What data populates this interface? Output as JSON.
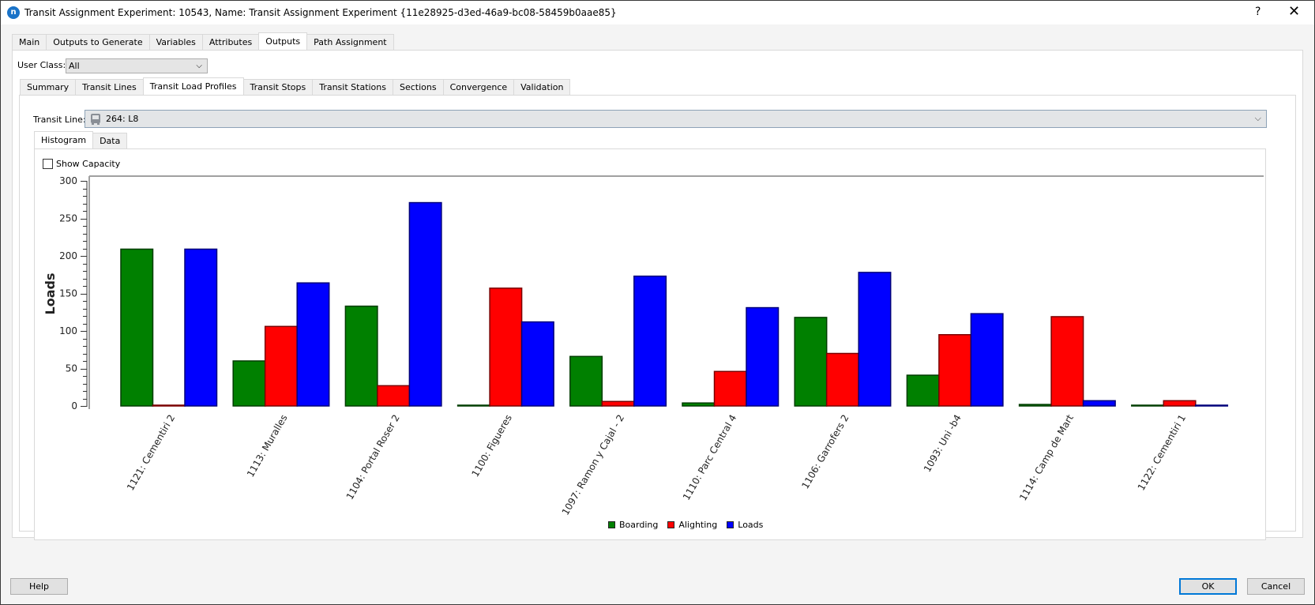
{
  "window": {
    "title": "Transit Assignment Experiment: 10543, Name: Transit Assignment Experiment  {11e28925-d3ed-46a9-bc08-58459b0aae85}",
    "app_icon": "n",
    "help_label": "?",
    "close_label": "✕"
  },
  "top_tabs": [
    {
      "label": "Main",
      "active": false
    },
    {
      "label": "Outputs to Generate",
      "active": false
    },
    {
      "label": "Variables",
      "active": false
    },
    {
      "label": "Attributes",
      "active": false
    },
    {
      "label": "Outputs",
      "active": true
    },
    {
      "label": "Path Assignment",
      "active": false
    }
  ],
  "user_class": {
    "label": "User Class:",
    "value": "All"
  },
  "sub_tabs": [
    {
      "label": "Summary",
      "active": false
    },
    {
      "label": "Transit Lines",
      "active": false
    },
    {
      "label": "Transit Load Profiles",
      "active": true
    },
    {
      "label": "Transit Stops",
      "active": false
    },
    {
      "label": "Transit Stations",
      "active": false
    },
    {
      "label": "Sections",
      "active": false
    },
    {
      "label": "Convergence",
      "active": false
    },
    {
      "label": "Validation",
      "active": false
    }
  ],
  "transit_line": {
    "label": "Transit Line:",
    "value": "264: L8",
    "icon": "bus-icon"
  },
  "view_tabs": [
    {
      "label": "Histogram",
      "active": true
    },
    {
      "label": "Data",
      "active": false
    }
  ],
  "show_capacity": {
    "label": "Show Capacity",
    "checked": false
  },
  "colors": {
    "boarding": "#008000",
    "alighting": "#ff0000",
    "loads": "#0000ff"
  },
  "chart_data": {
    "type": "bar",
    "title": "",
    "xlabel": "",
    "ylabel": "Loads",
    "ylim": [
      0,
      300
    ],
    "yticks": [
      0,
      50,
      100,
      150,
      200,
      250,
      300
    ],
    "grid": false,
    "legend_position": "bottom",
    "categories": [
      "1121: Cementiri 2",
      "1113: Muralles",
      "1104: Portal Roser 2",
      "1100: Figueres",
      "1097: Ramon y Cajal - 2",
      "1110: Parc Central 4",
      "1106: Garrofers 2",
      "1093: Uni -b4",
      "1114: Camp de Mart",
      "1122: Cementiri 1"
    ],
    "series": [
      {
        "name": "Boarding",
        "values": [
          209,
          60,
          133,
          0,
          66,
          4,
          118,
          41,
          2,
          0
        ]
      },
      {
        "name": "Alighting",
        "values": [
          0,
          106,
          27,
          157,
          6,
          46,
          70,
          95,
          119,
          7
        ]
      },
      {
        "name": "Loads",
        "values": [
          209,
          164,
          271,
          112,
          173,
          131,
          178,
          123,
          7,
          0
        ]
      }
    ]
  },
  "buttons": {
    "help": "Help",
    "ok": "OK",
    "cancel": "Cancel"
  }
}
